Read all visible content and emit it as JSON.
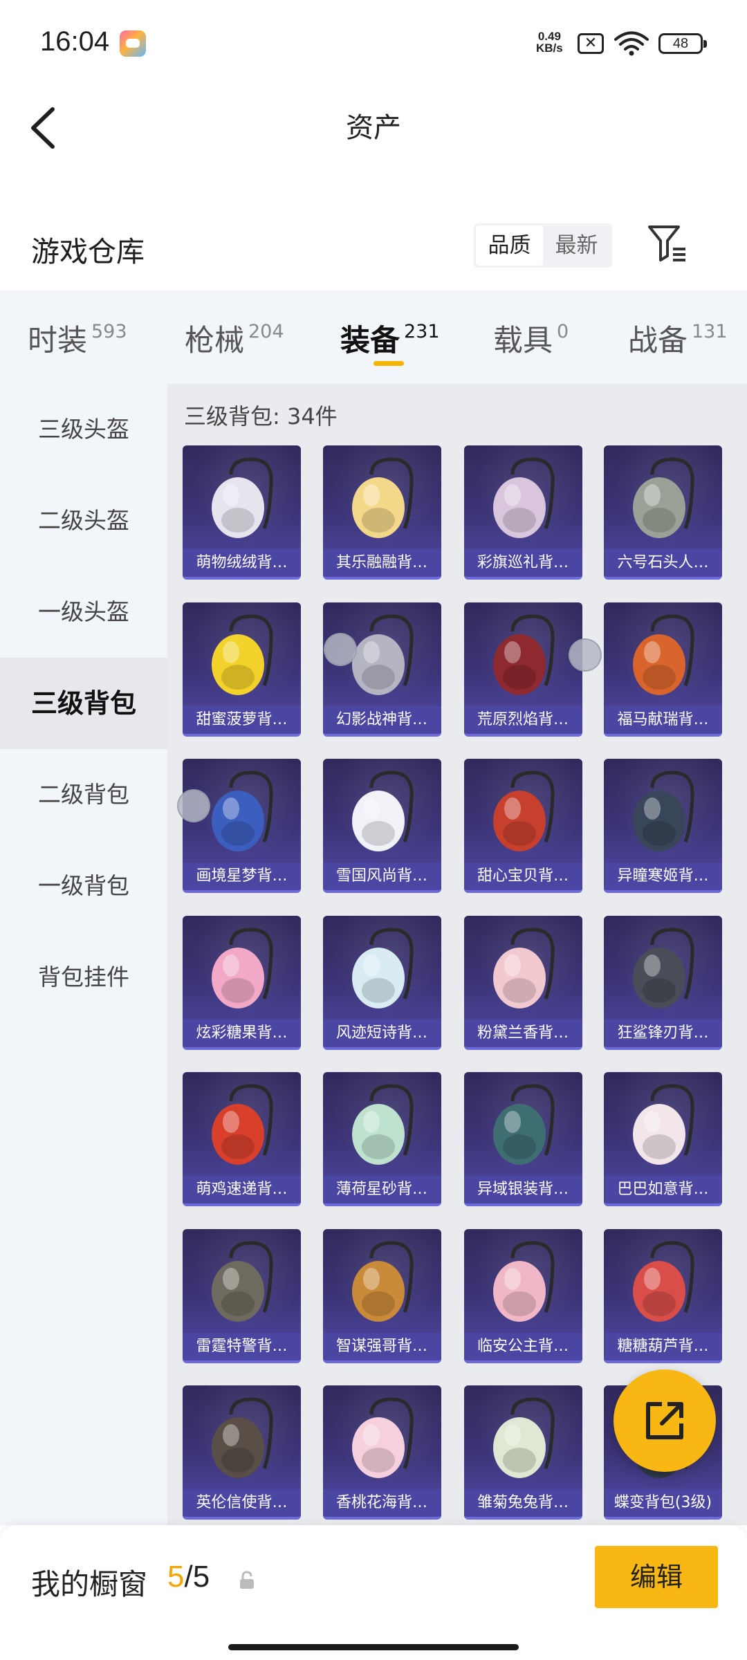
{
  "status_bar": {
    "time": "16:04",
    "net_speed_value": "0.49",
    "net_speed_unit": "KB/s",
    "battery": "48",
    "icons": [
      "game-app-icon",
      "sim-x-icon",
      "wifi-icon",
      "battery-icon"
    ]
  },
  "header": {
    "title": "资产",
    "back_icon": "chevron-left-icon"
  },
  "warehouse": {
    "title": "游戏仓库",
    "sort_options": [
      "品质",
      "最新"
    ],
    "sort_active": "品质",
    "filter_icon": "filter-icon"
  },
  "tabs": [
    {
      "label": "时装",
      "count": "593"
    },
    {
      "label": "枪械",
      "count": "204"
    },
    {
      "label": "装备",
      "count": "231",
      "active": true
    },
    {
      "label": "载具",
      "count": "0"
    },
    {
      "label": "战备",
      "count": "131"
    }
  ],
  "sidebar": [
    {
      "label": "三级头盔"
    },
    {
      "label": "二级头盔"
    },
    {
      "label": "一级头盔"
    },
    {
      "label": "三级背包",
      "active": true
    },
    {
      "label": "二级背包"
    },
    {
      "label": "一级背包"
    },
    {
      "label": "背包挂件"
    }
  ],
  "content": {
    "count_label": "三级背包: 34件",
    "items": [
      {
        "name": "萌物绒绒背…",
        "color": "#e8e4ee"
      },
      {
        "name": "其乐融融背…",
        "color": "#f3d88a"
      },
      {
        "name": "彩旗巡礼背…",
        "color": "#d9c6dd"
      },
      {
        "name": "六号石头人…",
        "color": "#9aa196"
      },
      {
        "name": "甜蜜菠萝背…",
        "color": "#f2d22b"
      },
      {
        "name": "幻影战神背…",
        "color": "#b5b4c2"
      },
      {
        "name": "荒原烈焰背…",
        "color": "#8e2a2f"
      },
      {
        "name": "福马献瑞背…",
        "color": "#d9652c"
      },
      {
        "name": "画境星梦背…",
        "color": "#3c5fbf"
      },
      {
        "name": "雪国风尚背…",
        "color": "#f1f2f8"
      },
      {
        "name": "甜心宝贝背…",
        "color": "#c7402e"
      },
      {
        "name": "异瞳寒姬背…",
        "color": "#39465a"
      },
      {
        "name": "炫彩糖果背…",
        "color": "#f2a9c8"
      },
      {
        "name": "风迹短诗背…",
        "color": "#d9ecf4"
      },
      {
        "name": "粉黛兰香背…",
        "color": "#f2c9cf"
      },
      {
        "name": "狂鲨锋刃背…",
        "color": "#4a4d57"
      },
      {
        "name": "萌鸡速递背…",
        "color": "#d8402c"
      },
      {
        "name": "薄荷星砂背…",
        "color": "#bfe2cf"
      },
      {
        "name": "异域银装背…",
        "color": "#3f6e72"
      },
      {
        "name": "巴巴如意背…",
        "color": "#f2e6ea"
      },
      {
        "name": "雷霆特警背…",
        "color": "#6f6a5e"
      },
      {
        "name": "智谋强哥背…",
        "color": "#c98a3a"
      },
      {
        "name": "临安公主背…",
        "color": "#f0b8c6"
      },
      {
        "name": "糖糖葫芦背…",
        "color": "#d94e48"
      },
      {
        "name": "英伦信使背…",
        "color": "#5a4f47"
      },
      {
        "name": "香桃花海背…",
        "color": "#f6d0dc"
      },
      {
        "name": "雏菊兔兔背…",
        "color": "#dfe8d2"
      },
      {
        "name": "蝶变背包(3级)",
        "color": "#2f3a4a"
      }
    ]
  },
  "fab": {
    "icon": "share-external-icon"
  },
  "bottom_bar": {
    "label": "我的橱窗",
    "current": "5",
    "separator": "/",
    "total": "5",
    "lock_icon": "lock-icon",
    "edit_label": "编辑"
  }
}
